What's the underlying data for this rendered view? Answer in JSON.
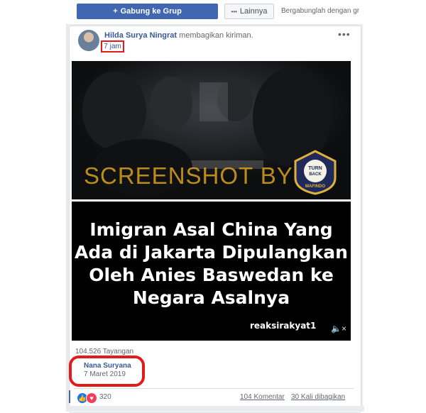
{
  "group_bar": {
    "join_label": "Gabung ke Grup",
    "more_label": "Lainnya",
    "hint": "Bergabunglah dengan grup"
  },
  "post": {
    "author": "Hilda Surya Ningrat",
    "action": "membagikan kiriman.",
    "time": "7 jam",
    "menu": "•••"
  },
  "video": {
    "watermark": "SCREENSHOT BY",
    "badge_text": "TURN BACK HOAX",
    "badge_ring": "MASYARAKAT ANTI FITNAH INDONESIA",
    "badge_org": "MAFINDO",
    "headline": "Imigran Asal China Yang Ada di Jakarta Dipulangkan Oleh Anies Baswedan ke Negara Asalnya",
    "channel": "reaksirakyat1"
  },
  "stats": {
    "views": "104.526 Tayangan",
    "sharer_name": "Nana Suryana",
    "sharer_date": "7 Maret 2019",
    "reactions": "320",
    "comments": "104 Komentar",
    "shares": "30 Kali dibagikan"
  },
  "colors": {
    "primary": "#4267b2",
    "highlight": "#e31b1b",
    "link": "#385898"
  }
}
